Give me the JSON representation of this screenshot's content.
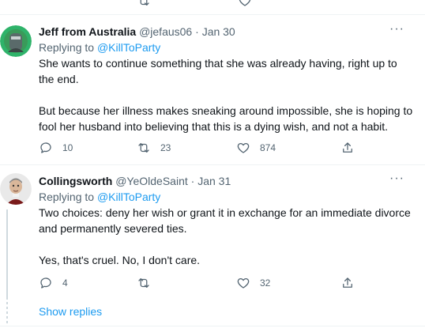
{
  "tweets": [
    {
      "display_name": "Jeff from Australia",
      "handle": "@jefaus06",
      "separator": "·",
      "date": "Jan 30",
      "more": "···",
      "replying_prefix": "Replying to",
      "replying_to": "@KillToParty",
      "paragraphs": [
        "She wants to continue something that she was already having, right up to the end.",
        "But because her illness makes sneaking around impossible, she is hoping to fool her husband into believing that this is a dying wish, and not a habit."
      ],
      "counts": {
        "replies": "10",
        "retweets": "23",
        "likes": "874"
      }
    },
    {
      "display_name": "Collingsworth",
      "handle": "@YeOldeSaint",
      "separator": "·",
      "date": "Jan 31",
      "more": "···",
      "replying_prefix": "Replying to",
      "replying_to": "@KillToParty",
      "paragraphs": [
        "Two choices: deny her wish or grant it in exchange for an immediate divorce and permanently severed ties.",
        "Yes, that's cruel. No, I don't care."
      ],
      "counts": {
        "replies": "4",
        "retweets": "",
        "likes": "32"
      }
    }
  ],
  "show_replies": "Show replies",
  "icons": [
    "reply-icon",
    "retweet-icon",
    "like-icon",
    "share-icon",
    "more-icon"
  ],
  "colors": {
    "link": "#1d9bf0",
    "muted": "#536471",
    "text": "#0f1419",
    "avatar1_bg": "#2fb36a",
    "avatar2_bg": "#e9e9e9"
  }
}
